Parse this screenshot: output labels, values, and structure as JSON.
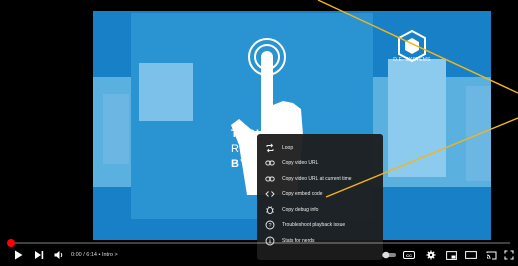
{
  "video": {
    "logo_text": "D.E. SYSTEMS",
    "logo_subtext": "",
    "title_line1": "TECHN",
    "title_line2": "REN",
    "title_line3": "BY D.E.S"
  },
  "context_menu": {
    "items": [
      {
        "icon": "loop-icon",
        "label": "Loop"
      },
      {
        "icon": "link-icon",
        "label": "Copy video URL"
      },
      {
        "icon": "link-icon",
        "label": "Copy video URL at current time"
      },
      {
        "icon": "embed-code-icon",
        "label": "Copy embed code"
      },
      {
        "icon": "debug-icon",
        "label": "Copy debug info"
      },
      {
        "icon": "question-icon",
        "label": "Troubleshoot playback issue"
      },
      {
        "icon": "info-icon",
        "label": "Stats for nerds"
      }
    ]
  },
  "controls": {
    "time_text": "0:00 / 6:14 • Intro >",
    "progress_fraction": 0.0,
    "cc_label": "CC"
  },
  "colors": {
    "video_bg": "#1780c7",
    "accent_red": "#ff0000",
    "annotation": "#f2b51a",
    "menu_bg": "#1c1c1c"
  }
}
